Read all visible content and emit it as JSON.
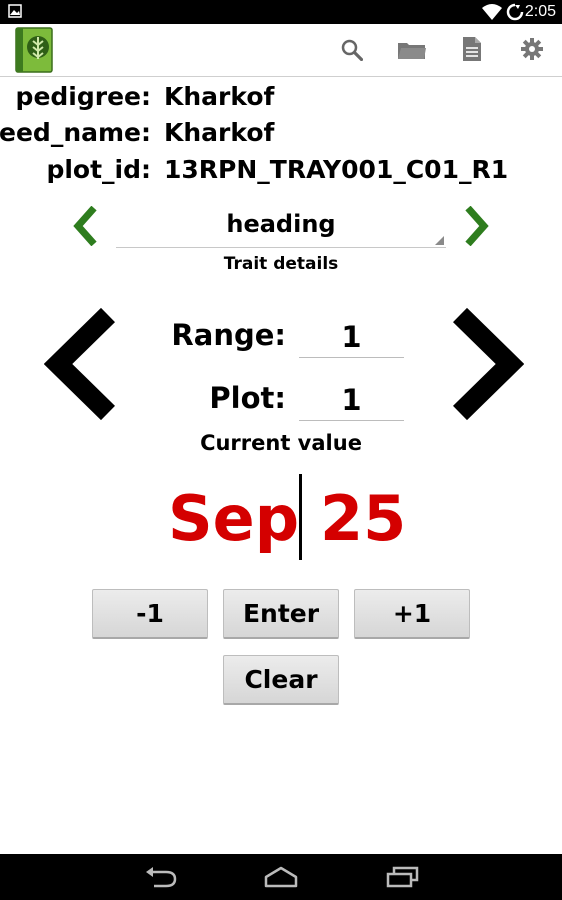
{
  "status_bar": {
    "time": "2:05"
  },
  "action_bar": {
    "icons": [
      "app-logo-icon",
      "search-icon",
      "folder-icon",
      "document-icon",
      "settings-gear-icon"
    ]
  },
  "info": {
    "pedigree_label": "pedigree:",
    "pedigree_value": "Kharkof",
    "seed_name_label": "seed_name:",
    "seed_name_value": "Kharkof",
    "plot_id_label": "plot_id:",
    "plot_id_value": "13RPN_TRAY001_C01_R1"
  },
  "trait": {
    "selected": "heading",
    "details_label": "Trait details"
  },
  "navigation": {
    "range_label": "Range:",
    "range_value": "1",
    "plot_label": "Plot:",
    "plot_value": "1"
  },
  "current": {
    "label": "Current value",
    "month": "Sep",
    "day": "25"
  },
  "buttons": {
    "minus": "-1",
    "enter": "Enter",
    "plus": "+1",
    "clear": "Clear"
  },
  "colors": {
    "accent_green": "#2e7d1e",
    "value_red": "#d40000"
  }
}
